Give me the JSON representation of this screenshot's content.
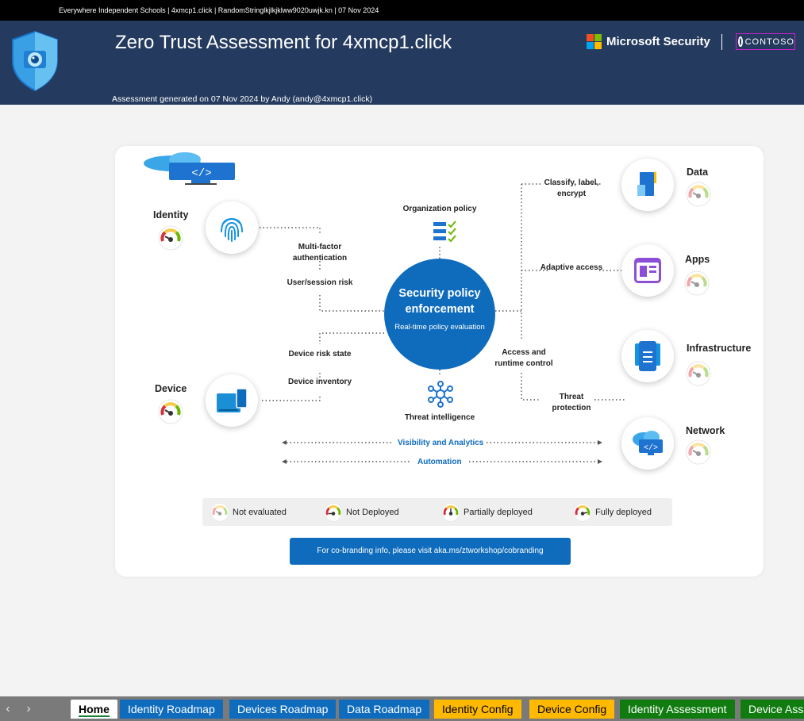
{
  "topbar": {
    "text": "Everywhere Independent Schools | 4xmcp1.click | RandomStringlkjlkjklww9020uwjk.kn | 07 Nov 2024"
  },
  "header": {
    "title": "Zero Trust Assessment for 4xmcp1.click",
    "subtitle": "Assessment generated on 07 Nov 2024 by Andy (andy@4xmcp1.click)",
    "ms_brand": "Microsoft Security",
    "partner_logo": "CONTOSO"
  },
  "diagram": {
    "center_title": "Security policy enforcement",
    "center_sub": "Real-time policy evaluation",
    "org_policy": "Organization policy",
    "threat_intel": "Threat intelligence",
    "left_labels": {
      "mfa": "Multi-factor authentication",
      "user_risk": "User/session risk",
      "device_risk": "Device risk state",
      "device_inventory": "Device inventory"
    },
    "right_labels": {
      "classify": "Classify, label, encrypt",
      "adaptive": "Adaptive access",
      "runtime": "Access and runtime control",
      "threat_protection": "Threat protection"
    },
    "pillars": {
      "identity": "Identity",
      "device": "Device",
      "data": "Data",
      "apps": "Apps",
      "infrastructure": "Infrastructure",
      "network": "Network"
    },
    "visibility": "Visibility and Analytics",
    "automation": "Automation"
  },
  "legend": {
    "not_evaluated": "Not evaluated",
    "not_deployed": "Not Deployed",
    "partial": "Partially deployed",
    "full": "Fully deployed"
  },
  "cobranding": "For co-branding info, please visit aka.ms/ztworkshop/cobranding",
  "colors": {
    "header": "#243a5e",
    "accent": "#0f6cbd",
    "yellow_tab": "#ffb900",
    "green_tab": "#107c10"
  },
  "tabs": {
    "home": "Home",
    "identity_roadmap": "Identity Roadmap",
    "devices_roadmap": "Devices Roadmap",
    "data_roadmap": "Data Roadmap",
    "identity_config": "Identity Config",
    "device_config": "Device Config",
    "identity_assessment": "Identity Assessment",
    "device_assessment": "Device Asse"
  },
  "nav": {
    "prev": "‹",
    "next": "›"
  }
}
